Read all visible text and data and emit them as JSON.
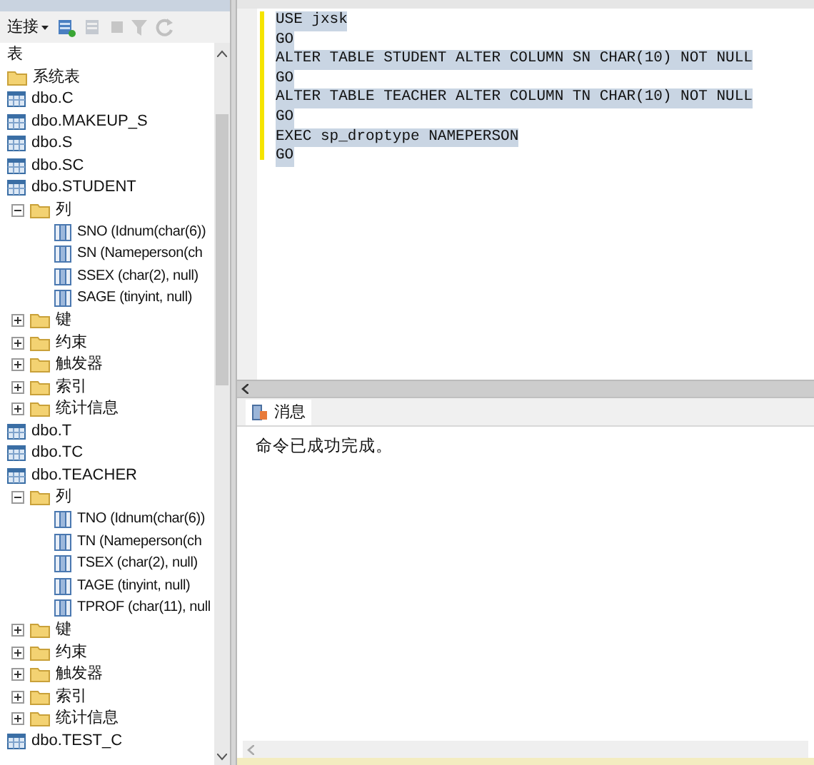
{
  "explorer": {
    "toolbar": {
      "connect_label": "连接"
    },
    "tree": {
      "label": "表",
      "items": [
        {
          "kind": "folder",
          "label": "系统表"
        },
        {
          "kind": "table",
          "label": "dbo.C"
        },
        {
          "kind": "table",
          "label": "dbo.MAKEUP_S"
        },
        {
          "kind": "table",
          "label": "dbo.S"
        },
        {
          "kind": "table",
          "label": "dbo.SC"
        },
        {
          "kind": "table",
          "label": "dbo.STUDENT",
          "children": [
            {
              "kind": "folder",
              "label": "列",
              "expanded": true,
              "children": [
                {
                  "kind": "column",
                  "label": "SNO (Idnum(char(6))"
                },
                {
                  "kind": "column",
                  "label": "SN (Nameperson(ch"
                },
                {
                  "kind": "column",
                  "label": "SSEX (char(2), null)"
                },
                {
                  "kind": "column",
                  "label": "SAGE (tinyint, null)"
                }
              ]
            },
            {
              "kind": "folder",
              "label": "键",
              "expanded": false
            },
            {
              "kind": "folder",
              "label": "约束",
              "expanded": false
            },
            {
              "kind": "folder",
              "label": "触发器",
              "expanded": false
            },
            {
              "kind": "folder",
              "label": "索引",
              "expanded": false
            },
            {
              "kind": "folder",
              "label": "统计信息",
              "expanded": false
            }
          ]
        },
        {
          "kind": "table",
          "label": "dbo.T"
        },
        {
          "kind": "table",
          "label": "dbo.TC"
        },
        {
          "kind": "table",
          "label": "dbo.TEACHER",
          "children": [
            {
              "kind": "folder",
              "label": "列",
              "expanded": true,
              "children": [
                {
                  "kind": "column",
                  "label": "TNO (Idnum(char(6))"
                },
                {
                  "kind": "column",
                  "label": "TN (Nameperson(ch"
                },
                {
                  "kind": "column",
                  "label": "TSEX (char(2), null)"
                },
                {
                  "kind": "column",
                  "label": "TAGE (tinyint, null)"
                },
                {
                  "kind": "column",
                  "label": "TPROF (char(11), null"
                }
              ]
            },
            {
              "kind": "folder",
              "label": "键",
              "expanded": false
            },
            {
              "kind": "folder",
              "label": "约束",
              "expanded": false
            },
            {
              "kind": "folder",
              "label": "触发器",
              "expanded": false
            },
            {
              "kind": "folder",
              "label": "索引",
              "expanded": false
            },
            {
              "kind": "folder",
              "label": "统计信息",
              "expanded": false
            }
          ]
        },
        {
          "kind": "table",
          "label": "dbo.TEST_C"
        }
      ]
    }
  },
  "editor": {
    "lines": [
      {
        "text": "USE jxsk",
        "selected": true
      },
      {
        "text": "GO",
        "selected": true
      },
      {
        "text": "ALTER TABLE STUDENT ALTER COLUMN SN CHAR(10) NOT NULL",
        "selected": true
      },
      {
        "text": "GO",
        "selected": true
      },
      {
        "text": "ALTER TABLE TEACHER ALTER COLUMN TN CHAR(10) NOT NULL",
        "selected": true
      },
      {
        "text": "GO",
        "selected": true
      },
      {
        "text": "EXEC sp_droptype NAMEPERSON",
        "selected": true
      },
      {
        "text": "GO",
        "selected": true
      }
    ]
  },
  "results": {
    "tabs": [
      {
        "label": "消息",
        "selected": true
      }
    ],
    "message": "命令已成功完成。"
  }
}
